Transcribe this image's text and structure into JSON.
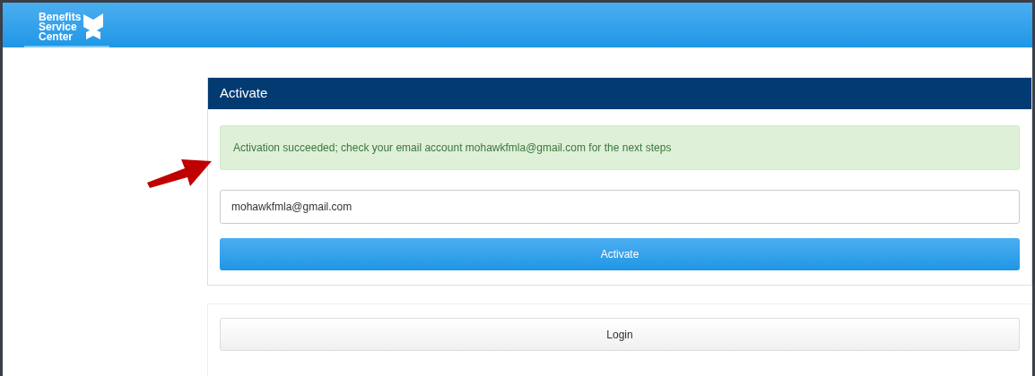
{
  "header": {
    "logo_lines": [
      "Benefits",
      "Service",
      "Center"
    ]
  },
  "panel": {
    "title": "Activate",
    "alert": "Activation succeeded; check your email account mohawkfmla@gmail.com for the next steps",
    "email_field": {
      "value": "mohawkfmla@gmail.com"
    },
    "submit_button": "Activate"
  },
  "login_button": "Login"
}
